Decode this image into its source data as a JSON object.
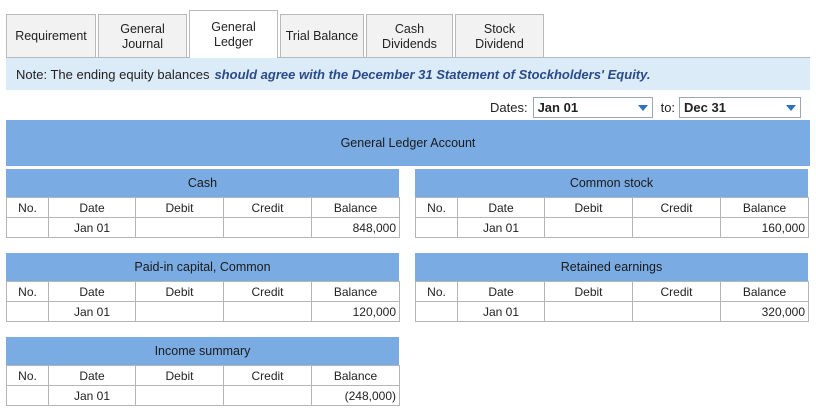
{
  "tabs": [
    {
      "label": "Requirement"
    },
    {
      "label": "General\nJournal"
    },
    {
      "label": "General\nLedger"
    },
    {
      "label": "Trial Balance"
    },
    {
      "label": "Cash\nDividends"
    },
    {
      "label": "Stock\nDividend"
    }
  ],
  "note": {
    "prefix": "Note:  The ending equity balances",
    "emphasis": "should agree with the December 31 Statement of Stockholders' Equity."
  },
  "dates": {
    "label": "Dates:",
    "from": "Jan 01",
    "to_label": "to:",
    "to": "Dec 31"
  },
  "ledger_title": "General Ledger Account",
  "columns": {
    "no": "No.",
    "date": "Date",
    "debit": "Debit",
    "credit": "Credit",
    "balance": "Balance"
  },
  "accounts": [
    {
      "name": "Cash",
      "date": "Jan 01",
      "balance": "848,000"
    },
    {
      "name": "Common stock",
      "date": "Jan 01",
      "balance": "160,000"
    },
    {
      "name": "Paid-in capital, Common",
      "date": "Jan 01",
      "balance": "120,000"
    },
    {
      "name": "Retained earnings",
      "date": "Jan 01",
      "balance": "320,000"
    },
    {
      "name": "Income summary",
      "date": "Jan 01",
      "balance": "(248,000)"
    }
  ]
}
